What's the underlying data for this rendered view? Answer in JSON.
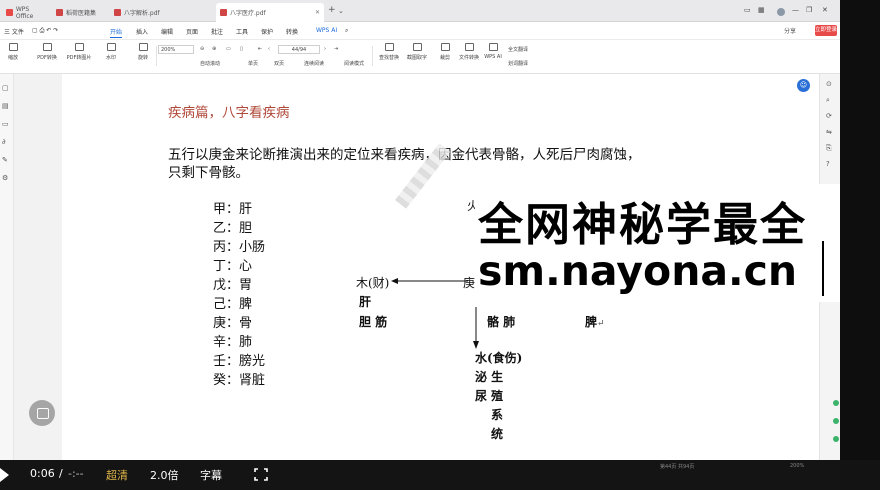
{
  "tabs": [
    {
      "label": "WPS Office",
      "color": "#e84a4a"
    },
    {
      "label": "稻荷医籍集",
      "color": "#d04545"
    },
    {
      "label": "八字解析.pdf",
      "color": "#d04545"
    },
    {
      "label": "八字医疗.pdf",
      "color": "#d04545"
    }
  ],
  "menu": {
    "file": "三 文件",
    "items": [
      "开始",
      "插入",
      "编辑",
      "页面",
      "批注",
      "工具",
      "保护",
      "转换"
    ],
    "wps_ai": "WPS AI",
    "share": "分享",
    "login": "立即登录"
  },
  "toolbar": {
    "buttons": [
      "缩放",
      "PDF转换",
      "PDF转图片",
      "水印",
      "旋转",
      "裁剪",
      "查找替换",
      "截图取字",
      "文件转换",
      "WPS AI",
      "全文翻译"
    ],
    "zoom": "200%",
    "page": "44/94",
    "labels": [
      "自动滚动",
      "单页",
      "双页",
      "连续阅读",
      "阅读模式",
      "划词翻译"
    ]
  },
  "document": {
    "title": "疾病篇，八字看疾病",
    "para_line1": "五行以庚金来论断推演出来的定位来看疾病，因金代表骨骼，人死后尸肉腐蚀，",
    "para_line2": "只剩下骨骸。",
    "organs": [
      "甲：肝",
      "乙：胆",
      "丙：小肠",
      "丁：心",
      "戊：胃",
      "己：脾",
      "庚：骨",
      "辛：肺",
      "壬：膀光",
      "癸：肾脏"
    ],
    "diagram": {
      "fire_top": "火",
      "wood": "木(财)",
      "liver": "肝",
      "gall": "胆 筋",
      "geng": "庚",
      "bone_lung": "骼 肺",
      "spleen": "脾",
      "water": "水(食伤)",
      "mi_sheng": "泌 生",
      "niao_zhi": "尿 殖",
      "xi": "系",
      "tong": "统"
    },
    "para_mark": "↵"
  },
  "watermark": {
    "line1": "全网神秘学最全",
    "line2": "sm.nayona.cn"
  },
  "player": {
    "time": "0:06",
    "separator": "/",
    "duration": "-:--",
    "quality": "超清",
    "speed": "2.0倍",
    "subtitle": "字幕"
  },
  "status": {
    "page_info": "第44页 共94页",
    "zoom_pct": "200%"
  },
  "colors": {
    "title_red": "#b04a3a",
    "accent_blue": "#1b6cd8",
    "gold": "#e0b64a"
  }
}
